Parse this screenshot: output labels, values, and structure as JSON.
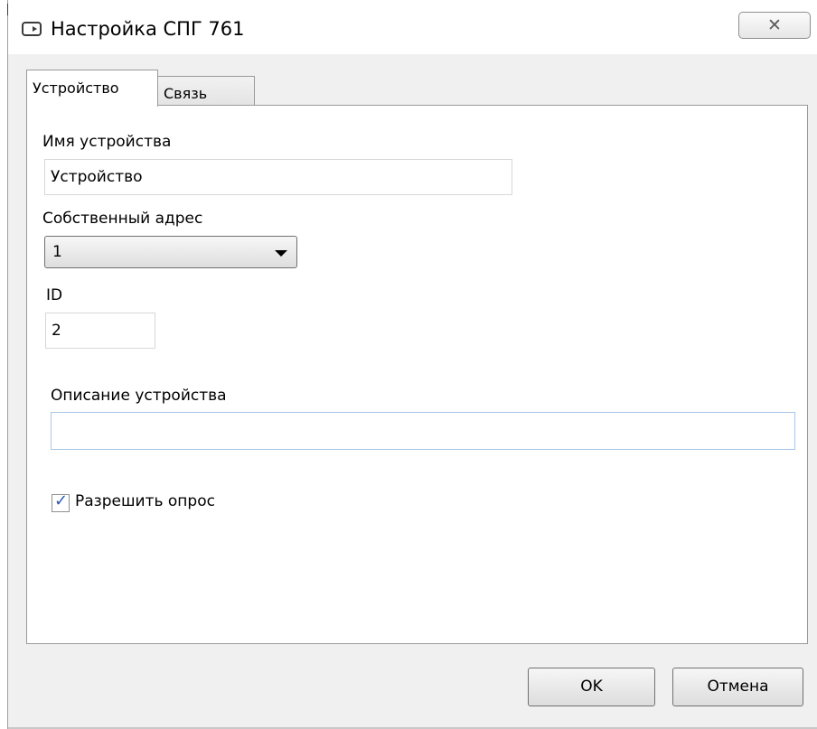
{
  "window": {
    "title": "Настройка СПГ 761",
    "close_icon": "close-x-icon"
  },
  "tabs": [
    {
      "label": "Устройство",
      "active": true
    },
    {
      "label": "Связь",
      "active": false
    }
  ],
  "device": {
    "name_label": "Имя устройства",
    "name_value": "Устройство",
    "address_label": "Собственный адрес",
    "address_value": "1",
    "id_label": "ID",
    "id_value": "2",
    "description_label": "Описание устройства",
    "description_value": "",
    "polling_label": "Разрешить опрос",
    "polling_checked": true
  },
  "buttons": {
    "ok": "OK",
    "cancel": "Отмена"
  }
}
